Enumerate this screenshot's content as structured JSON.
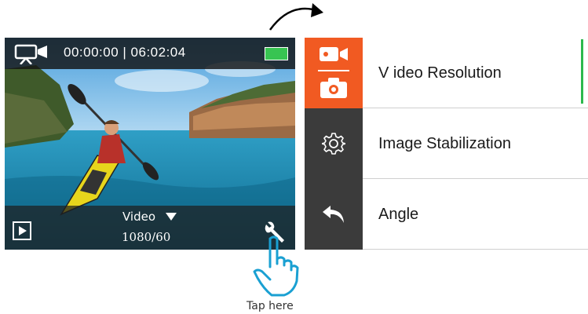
{
  "camera_screen": {
    "recording_icon": "video-camera-icon",
    "timecode": "00:00:00 | 06:02:04",
    "battery_color": "#38c452",
    "mode_label": "Video",
    "mode_dropdown_icon": "caret-down-icon",
    "resolution": "1080/60",
    "playback_icon": "play-icon",
    "settings_icon": "wrench-icon"
  },
  "menu": {
    "accent_color": "#f15a22",
    "items": [
      {
        "label": "V ideo Resolution",
        "icons": [
          "video-camera-icon",
          "photo-camera-icon"
        ],
        "active": true
      },
      {
        "label": "Image Stabilization",
        "icons": [
          "gear-icon"
        ],
        "active": false
      },
      {
        "label": "Angle",
        "icons": [
          "back-arrow-icon"
        ],
        "active": false
      }
    ]
  },
  "hint": {
    "label": "Tap here",
    "icon": "tap-hand-icon",
    "arrow_icon": "curved-arrow-icon"
  }
}
